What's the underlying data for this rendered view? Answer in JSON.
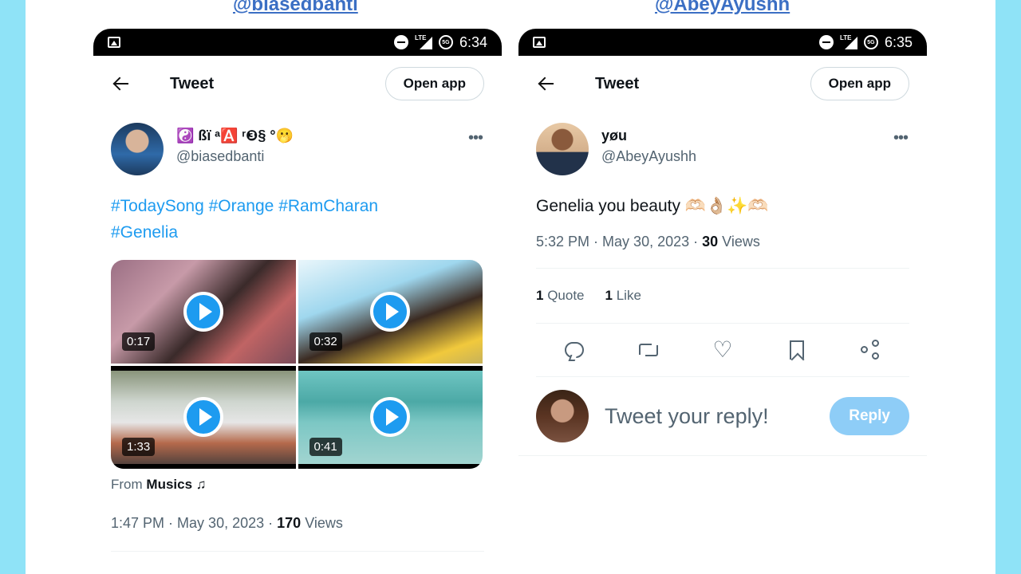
{
  "left": {
    "handle": "@biasedbanti",
    "status": {
      "time": "6:34"
    },
    "topbar": {
      "title": "Tweet",
      "open_app": "Open app"
    },
    "author": {
      "display_name": "☯️ ßï ᵃ🅰️ ʳ❸§   °🫢",
      "username": "@biasedbanti"
    },
    "text": {
      "tag1": "#TodaySong",
      "tag2": "#Orange",
      "tag3": "#RamCharan",
      "tag4": "#Genelia"
    },
    "media": [
      {
        "duration": "0:17"
      },
      {
        "duration": "0:32"
      },
      {
        "duration": "1:33"
      },
      {
        "duration": "0:41"
      }
    ],
    "source": {
      "prefix": "From",
      "name": "Musics ♫"
    },
    "meta": {
      "time": "1:47 PM",
      "date": "May 30, 2023",
      "views_count": "170",
      "views_label": "Views"
    }
  },
  "right": {
    "handle": "@AbeyAyushh",
    "status": {
      "time": "6:35"
    },
    "topbar": {
      "title": "Tweet",
      "open_app": "Open app"
    },
    "author": {
      "display_name": "yøu",
      "username": "@AbeyAyushh"
    },
    "text": "Genelia you beauty 🫶🏻👌🏼✨🫶🏻",
    "meta": {
      "time": "5:32 PM",
      "date": "May 30, 2023",
      "views_count": "30",
      "views_label": "Views"
    },
    "stats": {
      "quote_count": "1",
      "quote_label": "Quote",
      "like_count": "1",
      "like_label": "Like"
    },
    "reply": {
      "placeholder": "Tweet your reply!",
      "button": "Reply"
    }
  },
  "colors": {
    "background": "#8fe3f7",
    "accent": "#1d9bf0",
    "handle": "#3b6fc4"
  }
}
